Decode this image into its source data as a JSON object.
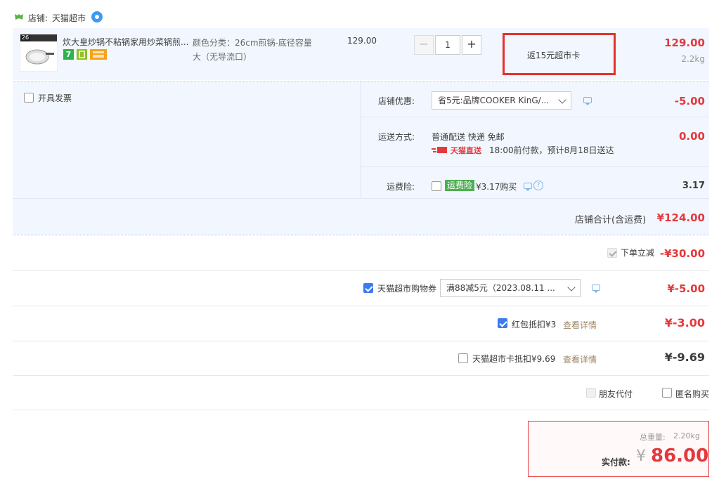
{
  "shop": {
    "label": "店铺:",
    "name": "天猫超市"
  },
  "item": {
    "title": "炊大皇炒锅不粘锅家用炒菜锅煎...",
    "thumb_badge": "26",
    "badge_seven": "7",
    "spec": "颜色分类：26cm煎锅-底径容量大（无导流口）",
    "unit_price": "129.00",
    "quantity": "1",
    "rebate": "返15元超市卡",
    "subtotal": "129.00",
    "weight": "2.2kg"
  },
  "invoice": {
    "label": "开具发票"
  },
  "shop_discount": {
    "label": "店铺优惠:",
    "selected": "省5元:品牌COOKER KinG/...",
    "amount": "-5.00"
  },
  "delivery": {
    "label": "运送方式:",
    "method": "普通配送 快递 免邮",
    "badge": "天猫直送",
    "eta": "18:00前付款，预计8月18日送达",
    "amount": "0.00"
  },
  "freight_insurance": {
    "label": "运费险:",
    "tag": "运费险",
    "price": "¥3.17购买",
    "amount": "3.17"
  },
  "shop_total": {
    "label": "店铺合计(含运费)",
    "amount": "¥124.00"
  },
  "instant_discount": {
    "label": "下单立减",
    "amount": "-¥30.00"
  },
  "coupon": {
    "label": "天猫超市购物券",
    "selected": "满88减5元（2023.08.11 ...",
    "amount": "¥-5.00"
  },
  "redpacket": {
    "label": "红包抵扣¥3",
    "link": "查看详情",
    "amount": "¥-3.00"
  },
  "card": {
    "label": "天猫超市卡抵扣¥9.69",
    "link": "查看详情",
    "amount": "¥-9.69"
  },
  "friend_pay": {
    "label": "朋友代付"
  },
  "anonymous": {
    "label": "匿名购买"
  },
  "summary": {
    "weight_label": "总重量:",
    "weight": "2.20kg",
    "pay_label": "实付款:",
    "currency": "¥",
    "pay_amount": "86.00"
  },
  "colors": {
    "accent_red": "#f40",
    "price_red": "#e4393c",
    "check_blue": "#3b7cf0",
    "panel_blue": "#f2f7ff",
    "highlight_box": "#e8302c"
  }
}
